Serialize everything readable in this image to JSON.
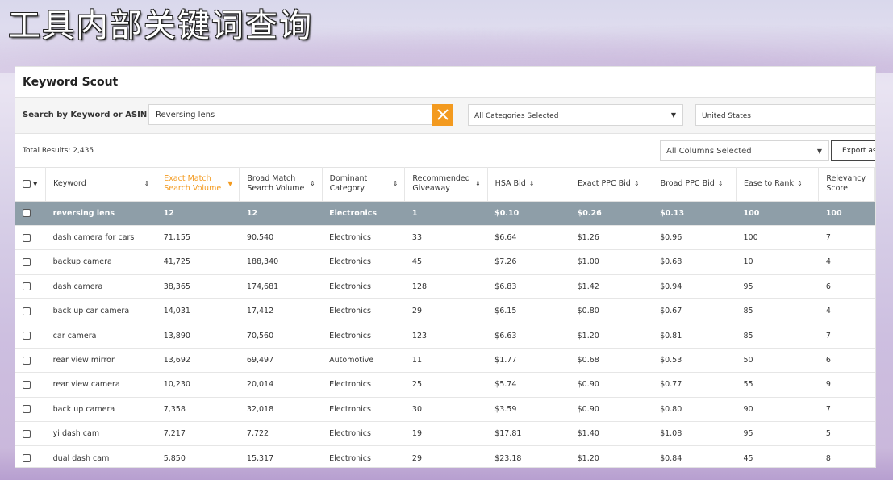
{
  "banner": {
    "text": "工具内部关键词查询"
  },
  "app": {
    "title": "Keyword Scout"
  },
  "search": {
    "label": "Search by Keyword or ASIN:",
    "value": "Reversing lens",
    "clear_icon": "close-icon"
  },
  "filters": {
    "categories": "All Categories Selected",
    "country": "United States",
    "columns": "All Columns Selected",
    "export_label": "Export as"
  },
  "results": {
    "label": "Total Results:",
    "count": "2,435"
  },
  "table": {
    "headers": [
      {
        "line1": "Keyword",
        "line2": ""
      },
      {
        "line1": "Exact Match",
        "line2": "Search Volume"
      },
      {
        "line1": "Broad Match",
        "line2": "Search Volume"
      },
      {
        "line1": "Dominant",
        "line2": "Category"
      },
      {
        "line1": "Recommended",
        "line2": "Giveaway"
      },
      {
        "line1": "HSA Bid",
        "line2": ""
      },
      {
        "line1": "Exact PPC Bid",
        "line2": ""
      },
      {
        "line1": "Broad PPC Bid",
        "line2": ""
      },
      {
        "line1": "Ease to Rank",
        "line2": ""
      },
      {
        "line1": "Relevancy",
        "line2": "Score"
      }
    ],
    "rows": [
      [
        "reversing lens",
        "12",
        "12",
        "Electronics",
        "1",
        "$0.10",
        "$0.26",
        "$0.13",
        "100",
        "100"
      ],
      [
        "dash camera for cars",
        "71,155",
        "90,540",
        "Electronics",
        "33",
        "$6.64",
        "$1.26",
        "$0.96",
        "100",
        "7"
      ],
      [
        "backup camera",
        "41,725",
        "188,340",
        "Electronics",
        "45",
        "$7.26",
        "$1.00",
        "$0.68",
        "10",
        "4"
      ],
      [
        "dash camera",
        "38,365",
        "174,681",
        "Electronics",
        "128",
        "$6.83",
        "$1.42",
        "$0.94",
        "95",
        "6"
      ],
      [
        "back up car camera",
        "14,031",
        "17,412",
        "Electronics",
        "29",
        "$6.15",
        "$0.80",
        "$0.67",
        "85",
        "4"
      ],
      [
        "car camera",
        "13,890",
        "70,560",
        "Electronics",
        "123",
        "$6.63",
        "$1.20",
        "$0.81",
        "85",
        "7"
      ],
      [
        "rear view mirror",
        "13,692",
        "69,497",
        "Automotive",
        "11",
        "$1.77",
        "$0.68",
        "$0.53",
        "50",
        "6"
      ],
      [
        "rear view camera",
        "10,230",
        "20,014",
        "Electronics",
        "25",
        "$5.74",
        "$0.90",
        "$0.77",
        "55",
        "9"
      ],
      [
        "back up camera",
        "7,358",
        "32,018",
        "Electronics",
        "30",
        "$3.59",
        "$0.90",
        "$0.80",
        "90",
        "7"
      ],
      [
        "yi dash cam",
        "7,217",
        "7,722",
        "Electronics",
        "19",
        "$17.81",
        "$1.40",
        "$1.08",
        "95",
        "5"
      ],
      [
        "dual dash cam",
        "5,850",
        "15,317",
        "Electronics",
        "29",
        "$23.18",
        "$1.20",
        "$0.84",
        "45",
        "8"
      ]
    ]
  }
}
